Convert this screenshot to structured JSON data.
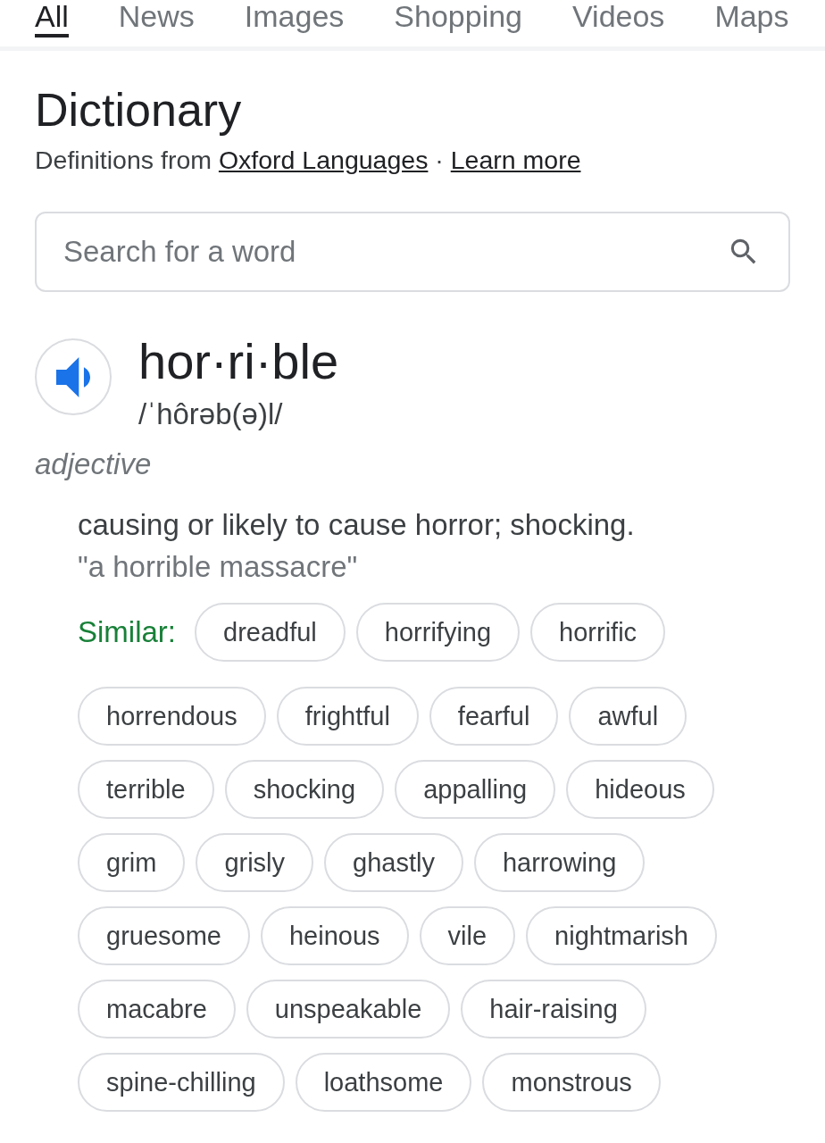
{
  "tabs": [
    {
      "label": "All",
      "selected": true
    },
    {
      "label": "News",
      "selected": false
    },
    {
      "label": "Images",
      "selected": false
    },
    {
      "label": "Shopping",
      "selected": false
    },
    {
      "label": "Videos",
      "selected": false
    },
    {
      "label": "Maps",
      "selected": false
    }
  ],
  "dictionary": {
    "title": "Dictionary",
    "attribution": {
      "text": "Definitions from",
      "source_link": "Oxford Languages",
      "separator": "·",
      "learn_more_link": "Learn more"
    },
    "search": {
      "placeholder": "Search for a word"
    }
  },
  "entry": {
    "headword": "hor·ri·ble",
    "pronunciation": "/ˈhôrəb(ə)l/",
    "part_of_speech": "adjective",
    "senses": [
      {
        "definition": "causing or likely to cause horror; shocking.",
        "example": "\"a horrible massacre\"",
        "similar": {
          "label": "Similar:",
          "rows": [
            [
              "dreadful",
              "horrifying",
              "horrific"
            ],
            [
              "horrendous",
              "frightful",
              "fearful",
              "awful"
            ],
            [
              "terrible",
              "shocking",
              "appalling",
              "hideous"
            ],
            [
              "grim",
              "grisly",
              "ghastly",
              "harrowing"
            ],
            [
              "gruesome",
              "heinous",
              "vile",
              "nightmarish"
            ],
            [
              "macabre",
              "unspeakable",
              "hair-raising"
            ],
            [
              "spine-chilling",
              "loathsome",
              "monstrous"
            ]
          ]
        }
      }
    ]
  }
}
